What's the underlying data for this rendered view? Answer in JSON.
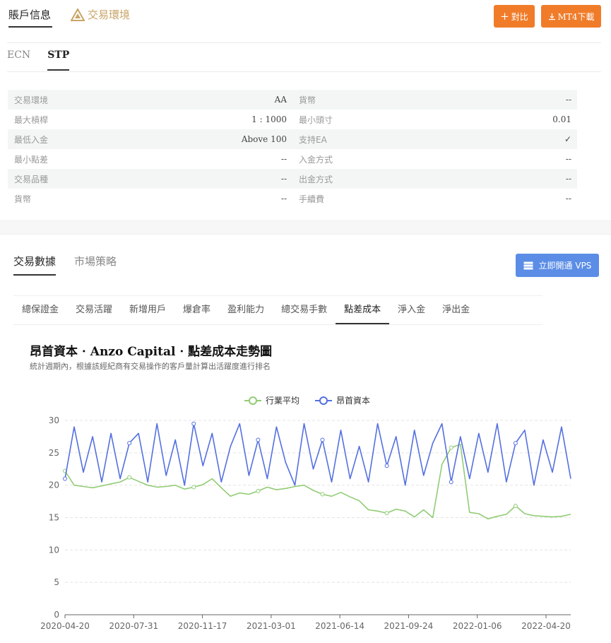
{
  "header": {
    "tabs": [
      {
        "label": "賬戶信息"
      },
      {
        "label": "交易環境"
      }
    ],
    "compare_label": "對比",
    "mt4_label": "MT4下載"
  },
  "account_tabs": [
    {
      "label": "ECN"
    },
    {
      "label": "STP"
    }
  ],
  "spec": {
    "rows": [
      {
        "left_label": "交易環境",
        "left_value": "AA",
        "right_label": "貨幣",
        "right_value": "--"
      },
      {
        "left_label": "最大槓桿",
        "left_value": "1 : 1000",
        "right_label": "最小頭寸",
        "right_value": "0.01"
      },
      {
        "left_label": "最低入金",
        "left_value": "Above 100",
        "right_label": "支持EA",
        "right_value": "✓"
      },
      {
        "left_label": "最小點差",
        "left_value": "--",
        "right_label": "入金方式",
        "right_value": "--"
      },
      {
        "left_label": "交易品種",
        "left_value": "--",
        "right_label": "出金方式",
        "right_value": "--"
      },
      {
        "left_label": "貨幣",
        "left_value": "--",
        "right_label": "手續費",
        "right_value": "--"
      }
    ]
  },
  "data_tabs": [
    {
      "label": "交易數據"
    },
    {
      "label": "市場策略"
    }
  ],
  "vps_label": "立即開通 VPS",
  "metric_tabs": [
    {
      "label": "總保證金"
    },
    {
      "label": "交易活躍"
    },
    {
      "label": "新增用戶"
    },
    {
      "label": "爆倉率"
    },
    {
      "label": "盈利能力"
    },
    {
      "label": "總交易手數"
    },
    {
      "label": "點差成本"
    },
    {
      "label": "淨入金"
    },
    {
      "label": "淨出金"
    }
  ],
  "chart_title": "昂首資本 · Anzo Capital · 點差成本走勢圖",
  "chart_subtitle": "統計週期內，根據該經紀商有交易操作的客戶量計算出活躍度進行排名",
  "colors": {
    "accent_orange": "#f07c2a",
    "vps_blue": "#5b8de6",
    "series_avg": "#91cc75",
    "series_broker": "#5470e0",
    "env_gold": "#c8a466"
  },
  "chart_data": {
    "type": "line",
    "legend_position": "top-center",
    "ylim": [
      0,
      30
    ],
    "yticks": [
      0,
      5,
      10,
      15,
      20,
      25,
      30
    ],
    "x_tick_labels": [
      "2020-04-20",
      "2020-07-31",
      "2020-11-17",
      "2021-03-01",
      "2021-06-14",
      "2021-09-24",
      "2022-01-06",
      "2022-04-20"
    ],
    "grid": "horizontal dashed",
    "series": [
      {
        "name": "行業平均",
        "color": "#91cc75",
        "values": [
          22.2,
          20.0,
          19.8,
          19.6,
          19.9,
          20.2,
          20.5,
          21.2,
          20.6,
          20.0,
          19.7,
          19.8,
          20.0,
          19.4,
          19.7,
          20.1,
          21.0,
          19.6,
          18.3,
          18.8,
          18.6,
          19.1,
          19.7,
          19.3,
          19.5,
          19.8,
          20.0,
          19.2,
          18.6,
          18.3,
          18.9,
          18.2,
          17.6,
          16.2,
          16.0,
          15.7,
          16.3,
          16.0,
          15.1,
          16.2,
          15.0,
          23.2,
          25.8,
          26.3,
          15.8,
          15.6,
          14.8,
          15.2,
          15.5,
          16.8,
          15.6,
          15.3,
          15.2,
          15.1,
          15.2,
          15.5
        ]
      },
      {
        "name": "昂首資本",
        "color": "#5470e0",
        "values": [
          21.0,
          29.0,
          22.0,
          27.5,
          20.5,
          28.0,
          21.0,
          26.5,
          28.0,
          20.5,
          29.5,
          21.5,
          27.0,
          20.0,
          29.5,
          23.0,
          28.0,
          20.5,
          26.0,
          29.5,
          21.5,
          27.0,
          21.0,
          29.0,
          23.5,
          20.0,
          29.5,
          22.5,
          27.0,
          20.5,
          28.5,
          21.0,
          26.0,
          20.5,
          29.5,
          23.0,
          27.5,
          20.0,
          28.5,
          21.5,
          26.5,
          29.5,
          20.5,
          27.5,
          21.0,
          28.0,
          22.0,
          29.5,
          20.5,
          26.5,
          28.5,
          20.0,
          27.0,
          22.0,
          29.0,
          21.0
        ]
      }
    ]
  }
}
